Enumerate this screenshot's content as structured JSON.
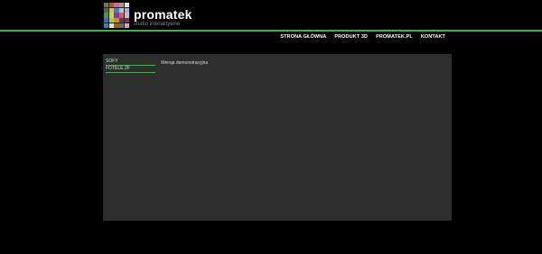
{
  "header": {
    "brand": "promatek",
    "tagline": "studio interaktywne",
    "logo_colors": [
      "#7a7a3a",
      "#c94f2e",
      "#d66a8f",
      "#9a9a9a",
      "#e0e0e0",
      "#4d6b2f",
      "#e6b84a",
      "#3c7bd0",
      "#c0c0c0",
      "#b8a6d6",
      "#3a9a5a",
      "#d0d050",
      "#7a3ab0",
      "#e05a5a",
      "#a0d0e0",
      "#5a5ad0",
      "#9ad05a",
      "#d08a3a",
      "#4a4a4a",
      "#8a2a5a",
      "#2a8aa0",
      "#e8e8a0",
      "#a05a2a",
      "#6a6a6a",
      "#d0a0c0"
    ]
  },
  "nav": {
    "items": [
      "STRONA GŁÓWNA",
      "PRODUKT 3D",
      "PROMATEK.PL",
      "KONTAKT"
    ]
  },
  "sidebar": {
    "items": [
      "SOFY",
      "FOTELE ZF"
    ]
  },
  "content": {
    "text": "Wersja demonstracyjna"
  },
  "colors": {
    "accent": "#39b54a",
    "background": "#000000",
    "panel": "#2d2d2d"
  }
}
